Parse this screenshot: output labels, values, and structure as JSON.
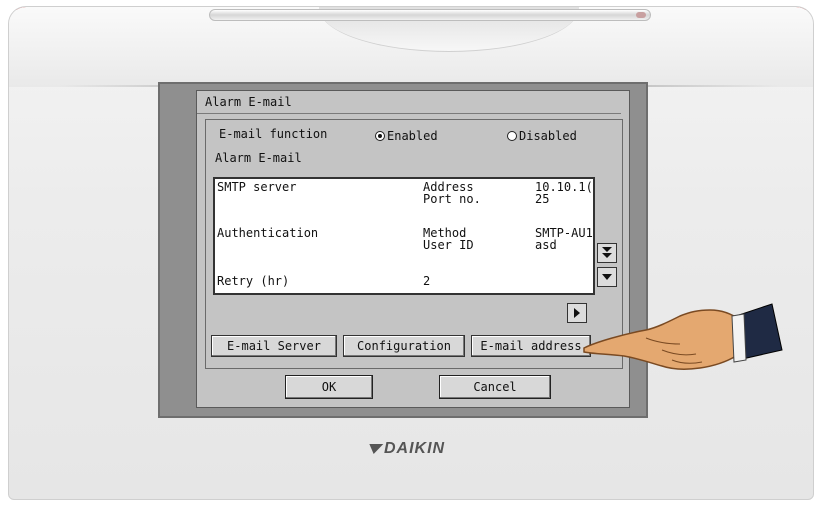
{
  "brand": "DAIKIN",
  "dialog": {
    "title": "Alarm E-mail",
    "email_function_label": "E-mail function",
    "enabled_label": "Enabled",
    "disabled_label": "Disabled",
    "selected": "Enabled",
    "section_label": "Alarm E-mail"
  },
  "list": {
    "rows": [
      {
        "name": "SMTP server",
        "keys": [
          "Address",
          "Port no."
        ],
        "values": [
          "10.10.1(",
          "25"
        ]
      },
      {
        "name": "Authentication",
        "keys": [
          "Method",
          "User ID"
        ],
        "values": [
          "SMTP-AU1",
          "asd"
        ]
      },
      {
        "name": "Retry (hr)",
        "keys": [
          "2"
        ],
        "values": [
          ""
        ]
      }
    ]
  },
  "tabs": {
    "email_server": "E-mail Server",
    "configuration": "Configuration",
    "email_address": "E-mail address"
  },
  "buttons": {
    "ok": "OK",
    "cancel": "Cancel"
  },
  "colors": {
    "screen_bg": "#c4c4c4",
    "frame": "#8f8f8f",
    "accent_red": "#b30000"
  }
}
